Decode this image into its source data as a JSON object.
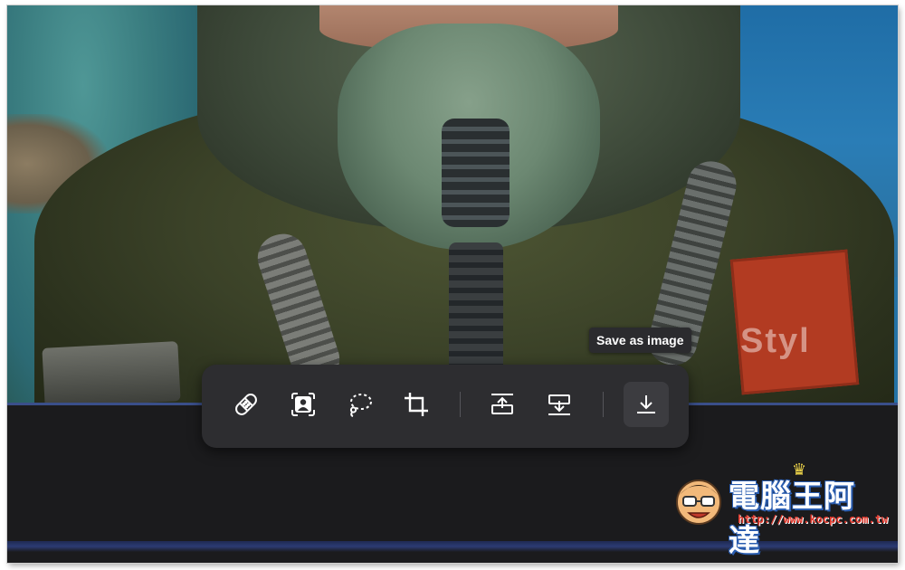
{
  "tooltip": {
    "label": "Save as image"
  },
  "toolbar": {
    "items": [
      {
        "name": "healing-tool",
        "icon": "bandage-icon"
      },
      {
        "name": "subject-select-tool",
        "icon": "person-select-icon"
      },
      {
        "name": "lasso-select-tool",
        "icon": "lasso-icon"
      },
      {
        "name": "crop-tool",
        "icon": "crop-icon"
      },
      {
        "name": "expand-up-tool",
        "icon": "expand-up-icon"
      },
      {
        "name": "expand-down-tool",
        "icon": "expand-down-icon"
      },
      {
        "name": "save-as-image-button",
        "icon": "download-icon",
        "active": true
      }
    ]
  },
  "photo": {
    "watermark": "Styl"
  },
  "logo": {
    "title": "電腦王阿達",
    "url": "http://www.kocpc.com.tw"
  },
  "colors": {
    "toolbar_bg": "#2d2d30",
    "app_bg": "#1b1b1d",
    "tooltip_bg": "#2b2b2e",
    "accent_line": "#3a4f8a"
  }
}
